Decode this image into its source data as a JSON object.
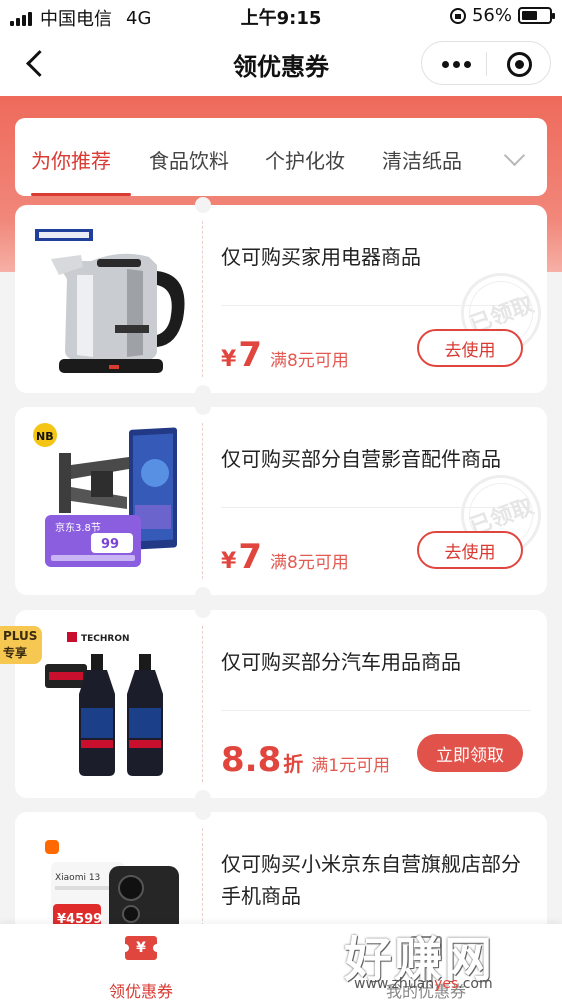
{
  "status_bar": {
    "carrier": "中国电信",
    "network": "4G",
    "time": "上午9:15",
    "battery": "56%",
    "battery_level": 0.56
  },
  "nav": {
    "title": "领优惠券"
  },
  "colors": {
    "accent": "#e0463e",
    "hero": "#ee6a5b",
    "plus": "#f6c851"
  },
  "tabs": [
    {
      "label": "为你推荐",
      "active": true
    },
    {
      "label": "食品饮料"
    },
    {
      "label": "个护化妆"
    },
    {
      "label": "清洁纸品"
    }
  ],
  "coupons": [
    {
      "title": "仅可购买家用电器商品",
      "symbol": "¥",
      "amount": "7",
      "condition": "满8元可用",
      "button": "去使用",
      "stamp": "已领取",
      "image": "electric-kettle"
    },
    {
      "title": "仅可购买部分自营影音配件商品",
      "symbol": "¥",
      "amount": "7",
      "condition": "满8元可用",
      "button": "去使用",
      "stamp": "已领取",
      "image": "tv-wall-mount",
      "image_text": {
        "brand": "NB",
        "promo": "京东3.8节",
        "price": "99"
      }
    },
    {
      "title": "仅可购买部分汽车用品商品",
      "amount": "8.8",
      "unit": "折",
      "condition": "满1元可用",
      "button": "立即领取",
      "badge": "PLUS专享",
      "badge_lines": [
        "PLUS",
        "专享"
      ],
      "image": "fuel-additive-bottles",
      "image_text": {
        "brand": "TECHRON"
      }
    },
    {
      "title": "仅可购买小米京东自营旗舰店部分手机商品",
      "image": "xiaomi-13-phone",
      "image_text": {
        "model": "Xiaomi 13",
        "price": "¥4599"
      }
    }
  ],
  "bottom_nav": [
    {
      "label": "领优惠券",
      "icon": "ticket-icon",
      "active": true
    },
    {
      "label": "我的优惠券",
      "icon": "my-ticket-icon"
    }
  ],
  "watermark": {
    "title": "好赚网",
    "site_pre": "www.zhuan",
    "site_yes": "yes",
    "site_post": ".com"
  }
}
